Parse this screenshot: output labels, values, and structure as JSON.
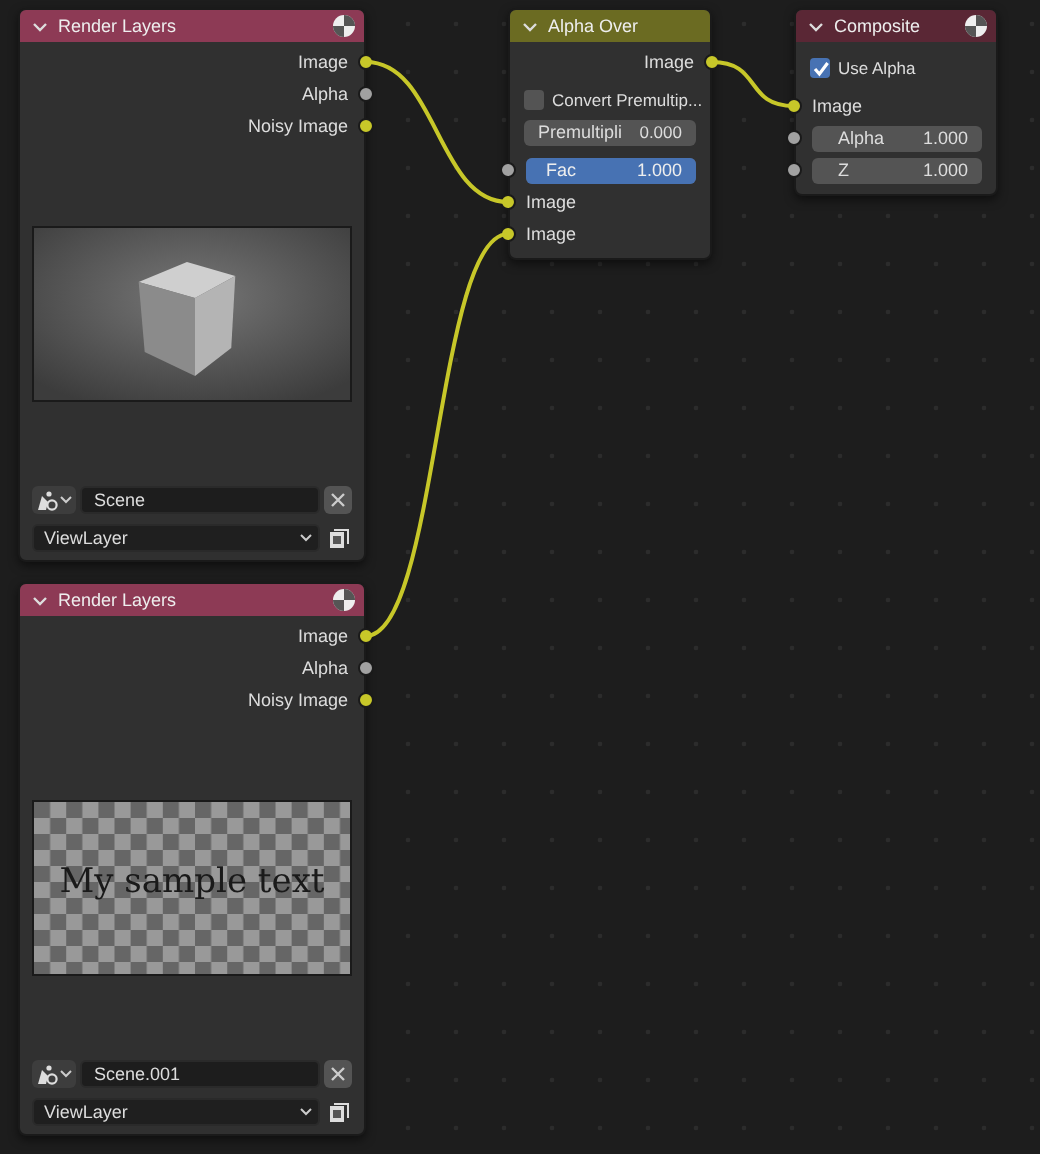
{
  "nodes": [
    {
      "kind": "render_layers",
      "title": "Render Layers",
      "outputs": [
        {
          "label": "Image",
          "color": "#c7c729",
          "linked": true
        },
        {
          "label": "Alpha",
          "color": "#a1a1a1",
          "linked": false
        },
        {
          "label": "Noisy Image",
          "color": "#c7c729",
          "linked": false
        }
      ],
      "preview": {
        "kind": "cube"
      },
      "scene": "Scene",
      "view_layer": "ViewLayer"
    },
    {
      "kind": "alpha_over",
      "title": "Alpha Over",
      "outputs": [
        {
          "label": "Image",
          "color": "#c7c729",
          "linked": true
        }
      ],
      "options": [
        {
          "kind": "checkbox",
          "label": "Convert Premultip...",
          "checked": false
        },
        {
          "kind": "number",
          "label": "Premultipli",
          "value": "0.000"
        }
      ],
      "inputs": [
        {
          "kind": "slider",
          "label": "Fac",
          "value": "1.000",
          "level": 1,
          "color": "#a1a1a1",
          "linked": false
        },
        {
          "kind": "socket",
          "label": "Image",
          "color": "#c7c729",
          "linked": true
        },
        {
          "kind": "socket",
          "label": "Image",
          "color": "#c7c729",
          "linked": true
        }
      ]
    },
    {
      "kind": "composite",
      "title": "Composite",
      "options": [
        {
          "kind": "checkbox",
          "label": "Use Alpha",
          "checked": true
        }
      ],
      "inputs": [
        {
          "kind": "socket",
          "label": "Image",
          "color": "#c7c729",
          "linked": true
        },
        {
          "kind": "number",
          "label": "Alpha",
          "value": "1.000",
          "color": "#a1a1a1",
          "linked": false
        },
        {
          "kind": "number",
          "label": "Z",
          "value": "1.000",
          "color": "#a1a1a1",
          "linked": false
        }
      ]
    },
    {
      "kind": "render_layers",
      "title": "Render Layers",
      "outputs": [
        {
          "label": "Image",
          "color": "#c7c729",
          "linked": true
        },
        {
          "label": "Alpha",
          "color": "#a1a1a1",
          "linked": false
        },
        {
          "label": "Noisy Image",
          "color": "#c7c729",
          "linked": false
        }
      ],
      "preview": {
        "kind": "checker",
        "text": "My sample text"
      },
      "scene": "Scene.001",
      "view_layer": "ViewLayer"
    }
  ]
}
